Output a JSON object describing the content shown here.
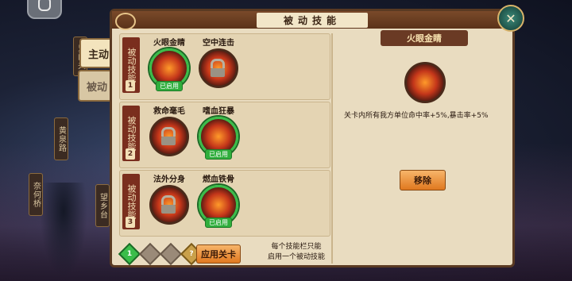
{
  "panel_title": "被动技能",
  "tabs": [
    {
      "label": "主动"
    },
    {
      "label": "被动"
    }
  ],
  "side_signs": [
    "鬼门关",
    "黄泉路",
    "奈何桥",
    "望乡台"
  ],
  "rows": [
    {
      "tag": "被动技能",
      "num": "1",
      "skills": [
        {
          "name": "火眼金睛",
          "state": "enabled",
          "badge": "已启用",
          "icon": "fire-eye-icon"
        },
        {
          "name": "空中连击",
          "state": "locked",
          "badge": "",
          "icon": "lock-icon"
        }
      ]
    },
    {
      "tag": "被动技能",
      "num": "2",
      "skills": [
        {
          "name": "救命毫毛",
          "state": "locked",
          "badge": "",
          "icon": "lock-icon"
        },
        {
          "name": "嗜血狂暴",
          "state": "enabled",
          "badge": "已启用",
          "icon": "berserk-icon"
        }
      ]
    },
    {
      "tag": "被动技能",
      "num": "3",
      "skills": [
        {
          "name": "法外分身",
          "state": "locked",
          "badge": "",
          "icon": "lock-icon"
        },
        {
          "name": "燃血铁骨",
          "state": "enabled",
          "badge": "已启用",
          "icon": "iron-bone-icon"
        }
      ]
    }
  ],
  "bottom": {
    "gems": [
      "1",
      "",
      "",
      "?"
    ],
    "apply_label": "应用关卡",
    "hint_line1": "每个技能栏只能",
    "hint_line2": "启用一个被动技能"
  },
  "detail": {
    "title": "火眼金睛",
    "description": "关卡内所有我方单位命中率+5%,暴击率+5%",
    "remove_label": "移除"
  },
  "colors": {
    "accent_green": "#2fae3c",
    "button_orange": "#e0781f",
    "panel_bg": "#e9dcc0",
    "tag_red": "#7a2e1e"
  }
}
